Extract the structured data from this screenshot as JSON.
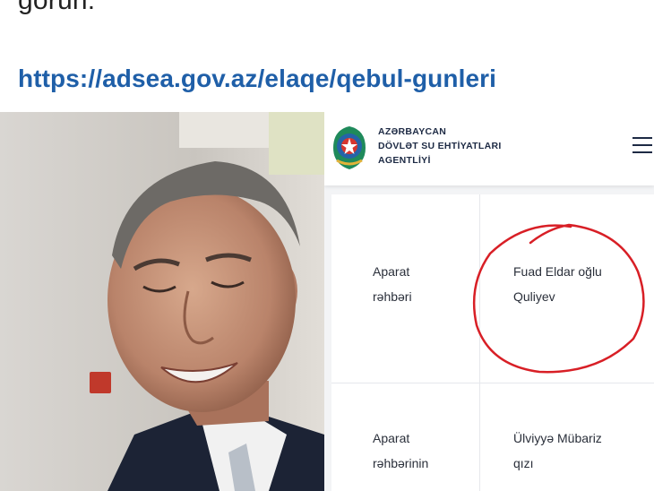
{
  "post": {
    "text_line": "görün:",
    "link": "https://adsea.gov.az/elaqe/qebul-gunleri"
  },
  "site": {
    "org_name_lines": [
      "AZƏRBAYCAN",
      "DÖVLƏT SU EHTİYATLARI",
      "AGENTLİYİ"
    ]
  },
  "table": {
    "rows": [
      {
        "position_lines": [
          "Aparat",
          "rəhbəri"
        ],
        "name_lines": [
          "Fuad Eldar oğlu",
          "Quliyev"
        ]
      },
      {
        "position_lines": [
          "Aparat",
          "rəhbərinin"
        ],
        "name_lines": [
          "Ülviyyə Mübariz",
          "qızı"
        ]
      }
    ]
  },
  "colors": {
    "link": "#1f5fa8",
    "circle_annotation": "#d81f26",
    "header_text": "#1d2a44"
  },
  "icons": {
    "menu": "hamburger-menu-icon",
    "emblem": "state-emblem-icon"
  }
}
